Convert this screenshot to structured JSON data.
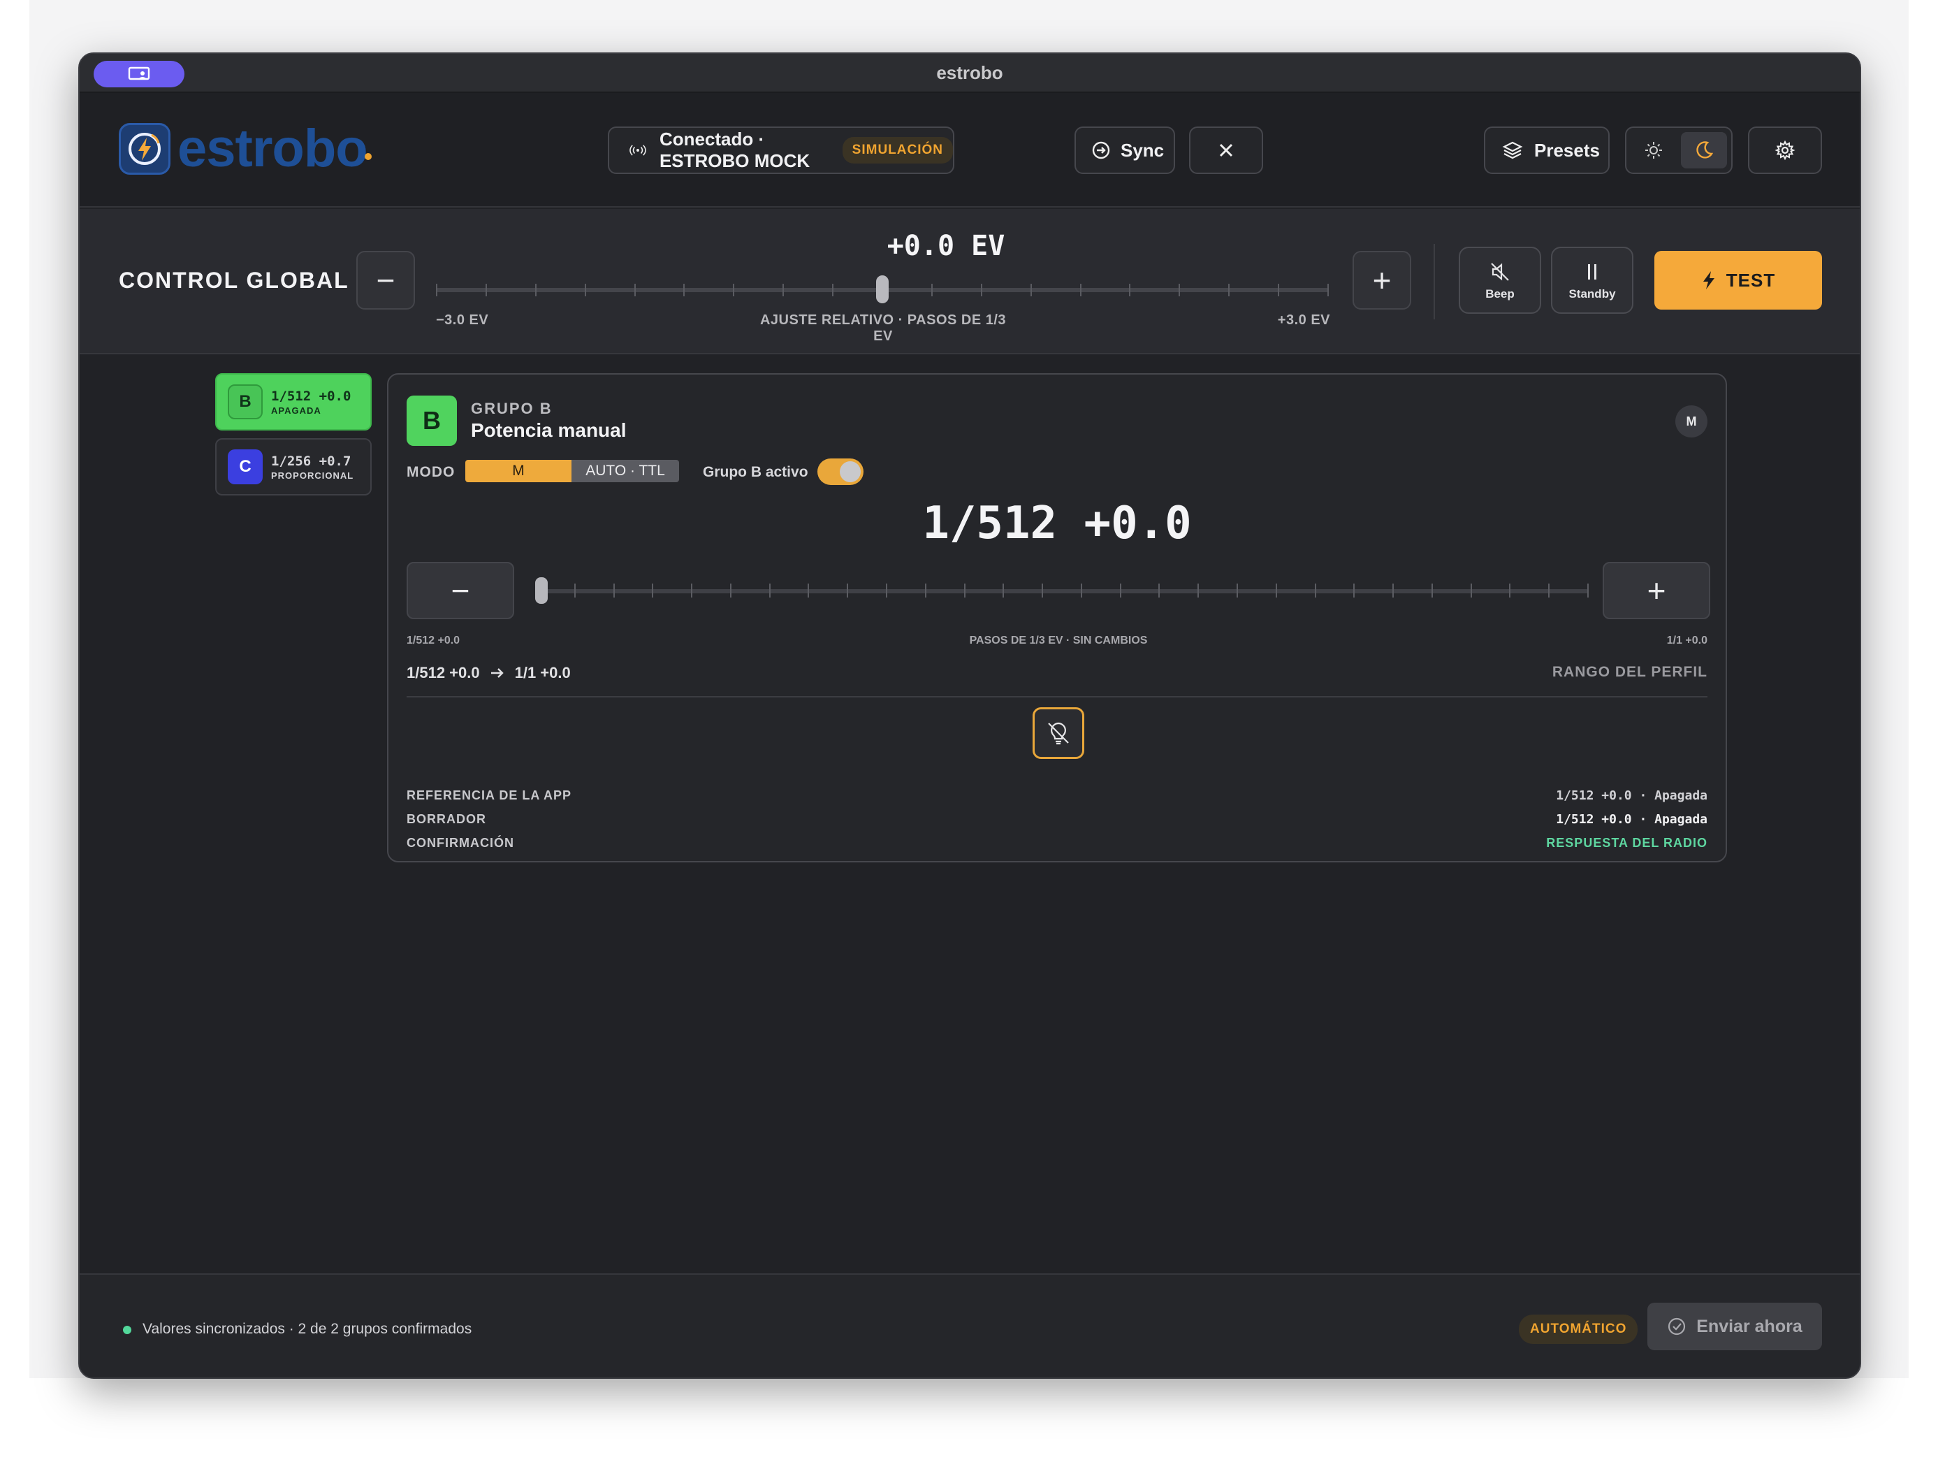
{
  "window": {
    "title": "estrobo"
  },
  "brand": {
    "name": "estrobo",
    "accent": "#f5a93a",
    "logo_color": "#1e4f96"
  },
  "header": {
    "connection_label": "Conectado · ESTROBO MOCK",
    "sim_badge": "SIMULACIÓN",
    "sync_label": "Sync",
    "presets_label": "Presets",
    "theme": {
      "selected": "dark"
    }
  },
  "global": {
    "title": "CONTROL GLOBAL",
    "value": "+0.0 EV",
    "min_label": "−3.0 EV",
    "center_label": "AJUSTE RELATIVO · PASOS DE 1/3 EV",
    "max_label": "+3.0 EV",
    "slider_fraction": 0.5,
    "beep_label": "Beep",
    "standby_label": "Standby",
    "test_label": "TEST"
  },
  "groups": [
    {
      "letter": "B",
      "value": "1/512 +0.0",
      "status": "APAGADA",
      "color": "#4ed25c",
      "selected": true
    },
    {
      "letter": "C",
      "value": "1/256 +0.7",
      "status": "PROPORCIONAL",
      "color": "#3b3fe0",
      "selected": false
    }
  ],
  "card": {
    "letter": "B",
    "group_label": "GRUPO B",
    "mode_name": "Potencia manual",
    "mode_badge": "M",
    "modo_label": "MODO",
    "mode_options": [
      "M",
      "AUTO · TTL"
    ],
    "mode_selected": "M",
    "active_label": "Grupo B activo",
    "active_on": true,
    "power_value": "1/512 +0.0",
    "slider_fraction": 0.0,
    "min_label": "1/512 +0.0",
    "center_label": "PASOS DE 1/3 EV · SIN CAMBIOS",
    "max_label": "1/1 +0.0",
    "range_from": "1/512 +0.0",
    "range_to": "1/1 +0.0",
    "range_label": "RANGO DEL PERFIL",
    "meta": [
      {
        "label": "REFERENCIA DE LA APP",
        "value": "1/512 +0.0 · Apagada"
      },
      {
        "label": "BORRADOR",
        "value": "1/512 +0.0 · Apagada"
      },
      {
        "label": "CONFIRMACIÓN",
        "value": "RESPUESTA DEL RADIO"
      }
    ]
  },
  "footer": {
    "status": "Valores sincronizados · 2 de 2 grupos confirmados",
    "auto_badge": "AUTOMÁTICO",
    "send_label": "Enviar ahora"
  }
}
